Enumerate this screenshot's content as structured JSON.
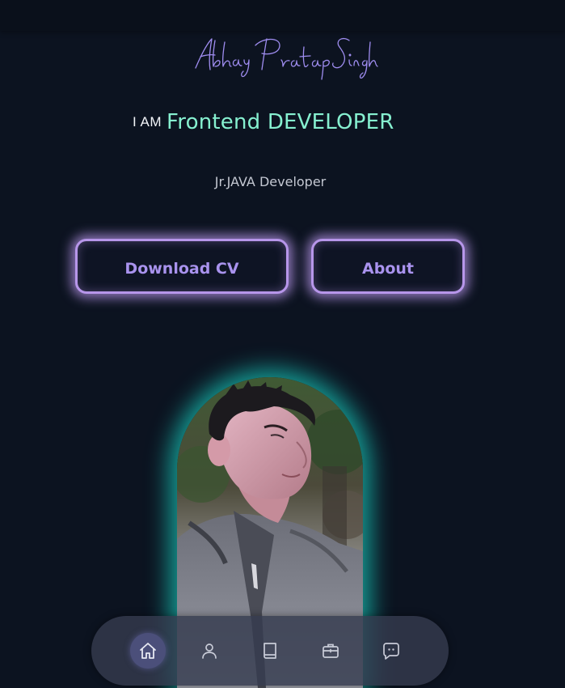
{
  "header": {
    "signature": "Abhay Pratap Singh"
  },
  "hero": {
    "prefix": "I AM",
    "role": "Frontend DEVELOPER",
    "subtitle": "Jr.JAVA Developer"
  },
  "buttons": {
    "download_cv": "Download CV",
    "about": "About"
  },
  "nav": {
    "items": [
      {
        "icon": "home-icon",
        "active": true
      },
      {
        "icon": "user-icon",
        "active": false
      },
      {
        "icon": "book-icon",
        "active": false
      },
      {
        "icon": "briefcase-icon",
        "active": false
      },
      {
        "icon": "chat-icon",
        "active": false
      }
    ]
  },
  "colors": {
    "background": "#0c1320",
    "accent_purple": "#b796ea",
    "accent_mint": "#86f0d0",
    "photo_glow": "#18c8b9"
  }
}
